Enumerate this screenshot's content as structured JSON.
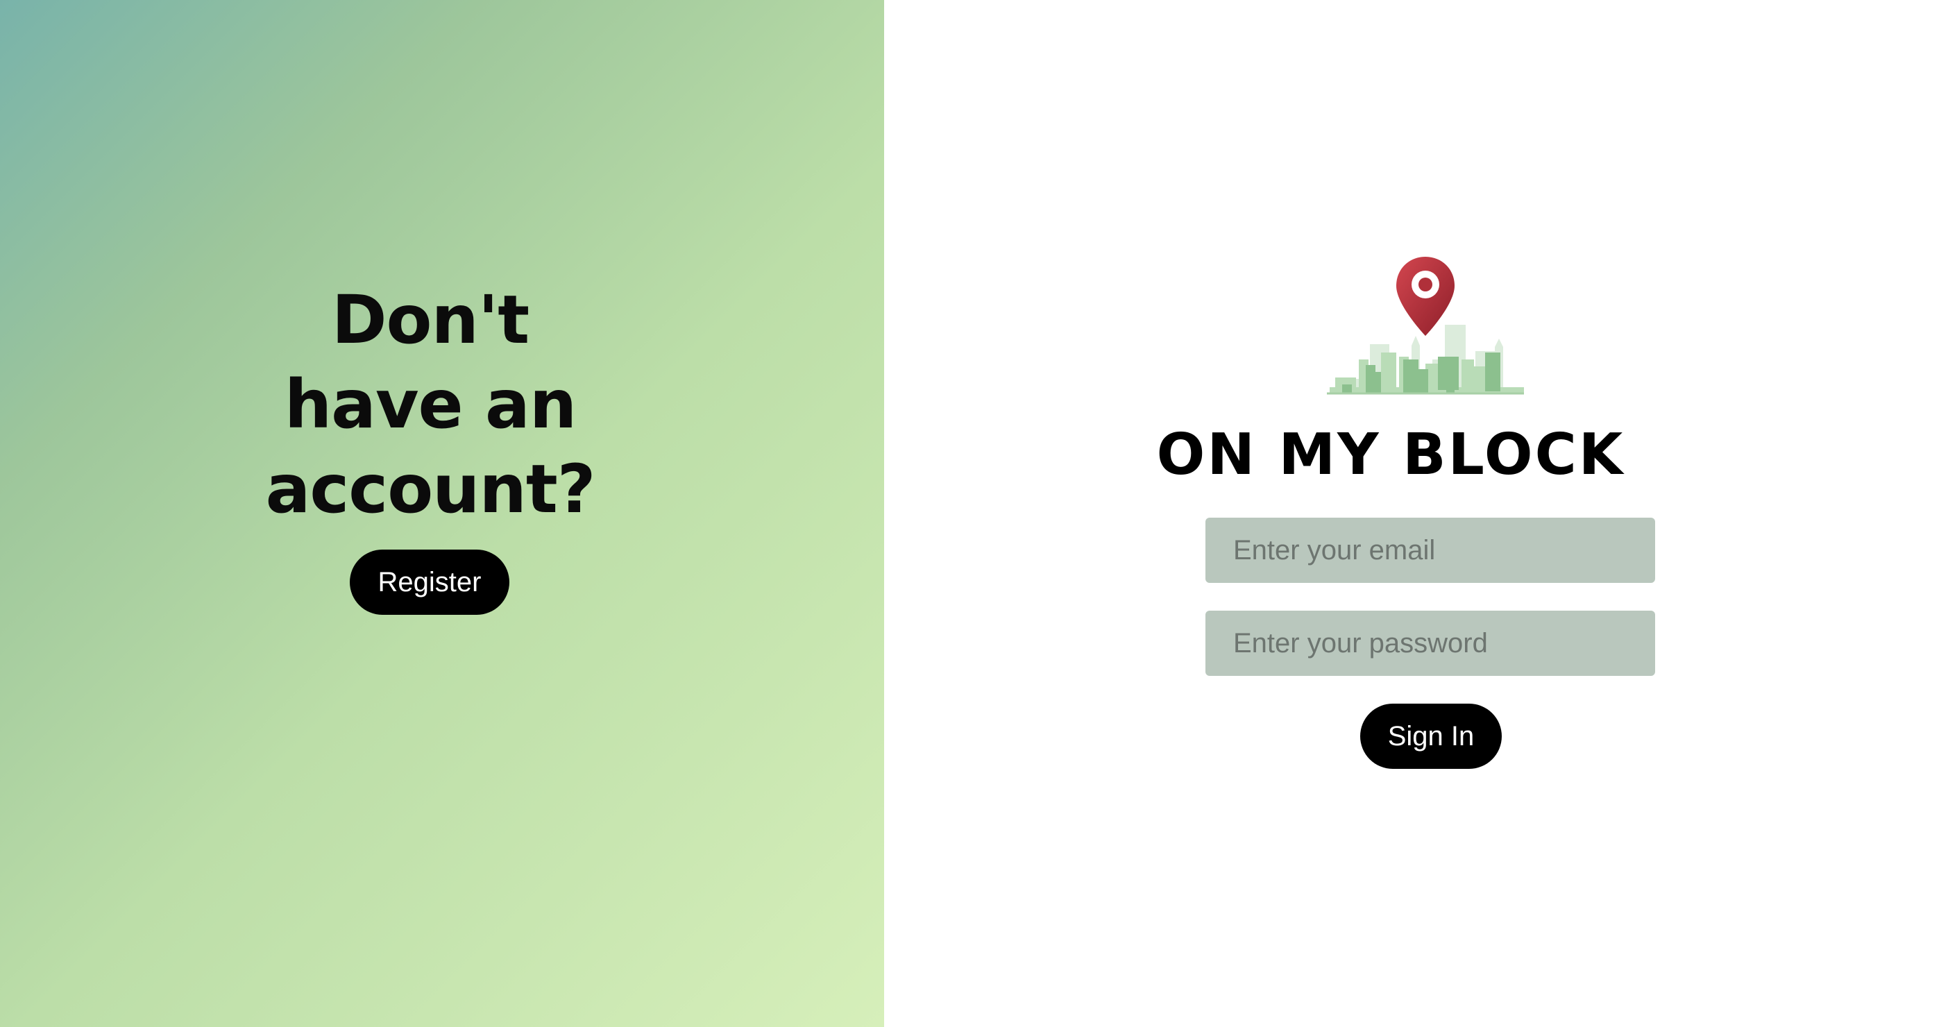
{
  "left": {
    "heading_line1": "Don't",
    "heading_line2": "have an",
    "heading_line3": "account?",
    "register_label": "Register"
  },
  "right": {
    "brand_name": "ON MY BLOCK",
    "logo_icon": "map-pin-city-skyline-icon",
    "email_placeholder": "Enter your email",
    "password_placeholder": "Enter your password",
    "signin_label": "Sign In"
  },
  "colors": {
    "gradient_start": "#79b3aa",
    "gradient_end": "#d6efba",
    "input_bg": "#b9c7bd",
    "button_bg": "#000000",
    "pin_red": "#b0303a"
  }
}
